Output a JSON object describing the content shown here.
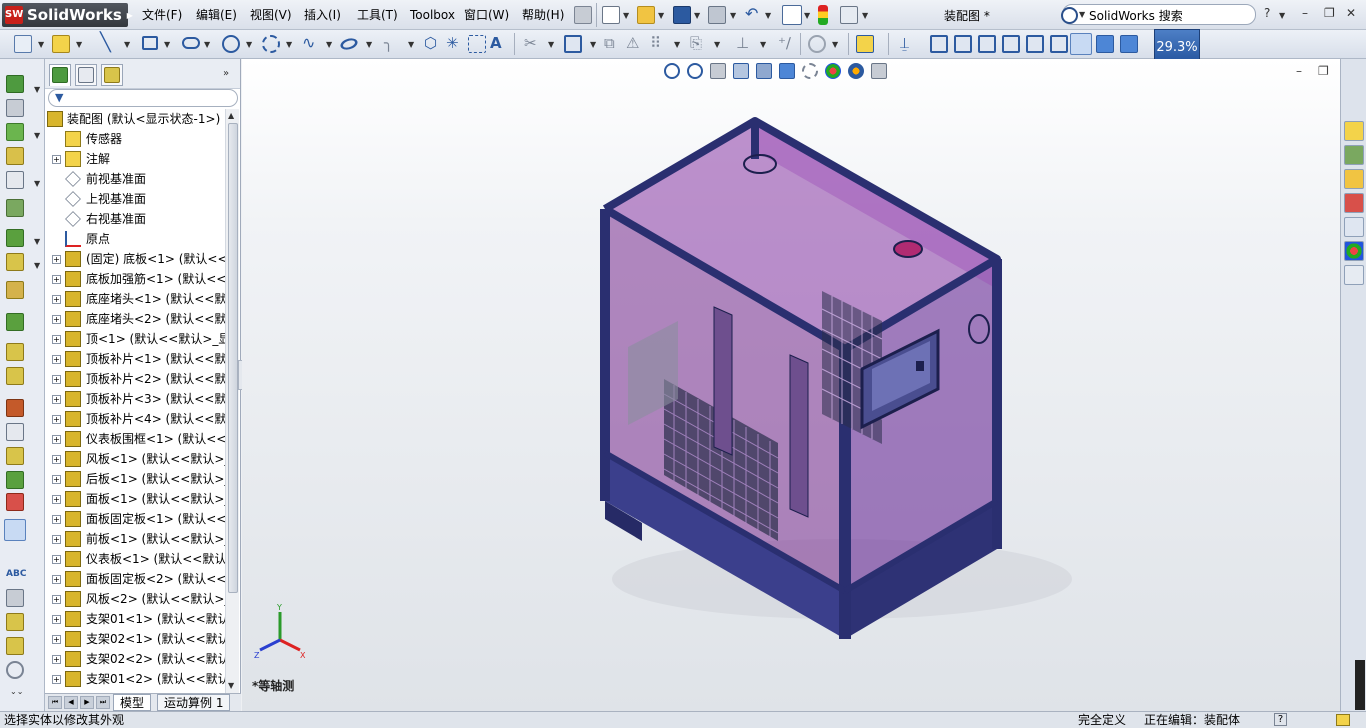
{
  "app": {
    "logo_text": "SolidWorks",
    "document_title": "装配图 *"
  },
  "menu": [
    "文件(F)",
    "编辑(E)",
    "视图(V)",
    "插入(I)",
    "工具(T)",
    "Toolbox",
    "窗口(W)",
    "帮助(H)"
  ],
  "search": {
    "text": "SolidWorks 搜索"
  },
  "zoom_tip": "29.3%",
  "feature_tree": {
    "root": "装配图 (默认<显示状态-1>)",
    "items": [
      {
        "label": "传感器",
        "icon": "sensor-icon",
        "expand": false
      },
      {
        "label": "注解",
        "icon": "annotation-icon",
        "expand": true
      },
      {
        "label": "前视基准面",
        "icon": "plane-icon",
        "expand": false
      },
      {
        "label": "上视基准面",
        "icon": "plane-icon",
        "expand": false
      },
      {
        "label": "右视基准面",
        "icon": "plane-icon",
        "expand": false
      },
      {
        "label": "原点",
        "icon": "origin-icon",
        "expand": false
      },
      {
        "label": "(固定) 底板<1> (默认<<",
        "icon": "part-icon",
        "expand": true
      },
      {
        "label": "底板加强筋<1> (默认<<",
        "icon": "part-icon",
        "expand": true
      },
      {
        "label": "底座堵头<1> (默认<<默",
        "icon": "part-icon",
        "expand": true
      },
      {
        "label": "底座堵头<2> (默认<<默",
        "icon": "part-icon",
        "expand": true
      },
      {
        "label": "顶<1> (默认<<默认>_显",
        "icon": "part-icon",
        "expand": true
      },
      {
        "label": "顶板补片<1> (默认<<默",
        "icon": "part-icon",
        "expand": true
      },
      {
        "label": "顶板补片<2> (默认<<默",
        "icon": "part-icon",
        "expand": true
      },
      {
        "label": "顶板补片<3> (默认<<默",
        "icon": "part-icon",
        "expand": true
      },
      {
        "label": "顶板补片<4> (默认<<默",
        "icon": "part-icon",
        "expand": true
      },
      {
        "label": "仪表板围框<1> (默认<<",
        "icon": "part-icon",
        "expand": true
      },
      {
        "label": "风板<1> (默认<<默认>_",
        "icon": "part-icon",
        "expand": true
      },
      {
        "label": "后板<1> (默认<<默认>_",
        "icon": "part-icon",
        "expand": true
      },
      {
        "label": "面板<1> (默认<<默认>_",
        "icon": "part-icon",
        "expand": true
      },
      {
        "label": "面板固定板<1> (默认<<",
        "icon": "part-icon",
        "expand": true
      },
      {
        "label": "前板<1> (默认<<默认>_",
        "icon": "part-icon",
        "expand": true
      },
      {
        "label": "仪表板<1> (默认<<默认",
        "icon": "part-icon",
        "expand": true
      },
      {
        "label": "面板固定板<2> (默认<<",
        "icon": "part-icon",
        "expand": true
      },
      {
        "label": "风板<2> (默认<<默认>_",
        "icon": "part-icon",
        "expand": true
      },
      {
        "label": "支架01<1> (默认<<默认",
        "icon": "part-icon",
        "expand": true
      },
      {
        "label": "支架02<1> (默认<<默认",
        "icon": "part-icon",
        "expand": true
      },
      {
        "label": "支架02<2> (默认<<默认",
        "icon": "part-icon",
        "expand": true
      },
      {
        "label": "支架01<2> (默认<<默认",
        "icon": "part-icon",
        "expand": true
      }
    ]
  },
  "bottom_tabs": [
    "模型",
    "运动算例 1"
  ],
  "view_label": "*等轴测",
  "triad": {
    "x": "X",
    "y": "Y",
    "z": "Z"
  },
  "status": {
    "left": "选择实体以修改其外观",
    "define": "完全定义",
    "editing": "正在编辑：装配体",
    "help": "?"
  },
  "colors": {
    "accent": "#2a5aa3",
    "model_frame": "#3b3f8c",
    "model_panel": "#7a2e8f"
  }
}
